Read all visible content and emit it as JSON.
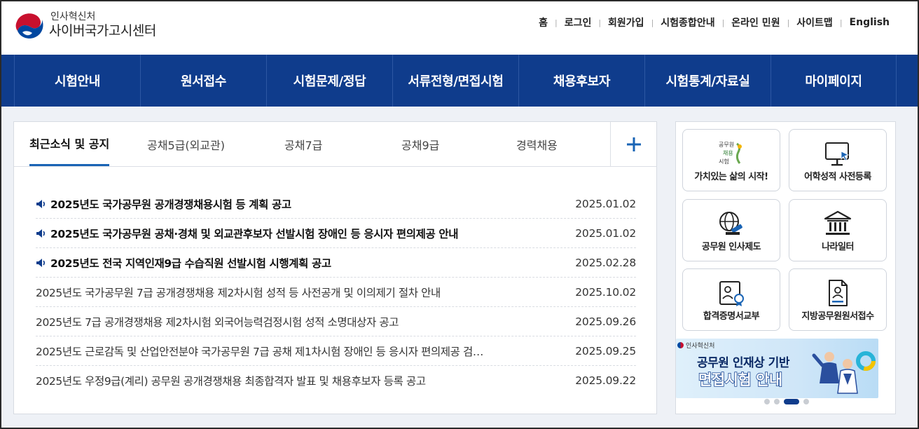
{
  "header": {
    "org": "인사혁신처",
    "site_name": "사이버국가고시센터",
    "util_links": [
      "홈",
      "로그인",
      "회원가입",
      "시험종합안내",
      "온라인 민원",
      "사이트맵",
      "English"
    ]
  },
  "nav": [
    "시험안내",
    "원서접수",
    "시험문제/정답",
    "서류전형/면접시험",
    "채용후보자",
    "시험통계/자료실",
    "마이페이지"
  ],
  "notice": {
    "tabs": [
      "최근소식 및 공지",
      "공채5급(외교관)",
      "공채7급",
      "공채9급",
      "경력채용"
    ],
    "active_tab": 0,
    "plus_icon": "plus-icon",
    "items": [
      {
        "title": "2025년도 국가공무원 공개경쟁채용시험 등 계획 공고",
        "date": "2025.01.02",
        "important": true
      },
      {
        "title": "2025년도 국가공무원 공채·경채 및 외교관후보자 선발시험 장애인 등 응시자 편의제공 안내",
        "date": "2025.01.02",
        "important": true
      },
      {
        "title": "2025년도 전국 지역인재9급 수습직원 선발시험 시행계획 공고",
        "date": "2025.02.28",
        "important": true
      },
      {
        "title": "2025년도 국가공무원 7급 공개경쟁채용 제2차시험 성적 등 사전공개 및 이의제기 절차 안내",
        "date": "2025.10.02",
        "important": false
      },
      {
        "title": "2025년도 7급 공개경쟁채용 제2차시험 외국어능력검정시험 성적 소명대상자 공고",
        "date": "2025.09.26",
        "important": false
      },
      {
        "title": "2025년도 근로감독 및 산업안전분야 국가공무원 7급 공채 제1차시험 장애인 등 응시자 편의제공 검…",
        "date": "2025.09.25",
        "important": false
      },
      {
        "title": "2025년도 우정9급(계리) 공무원 공개경쟁채용 최종합격자 발표 및 채용후보자 등록 공고",
        "date": "2025.09.22",
        "important": false
      }
    ]
  },
  "quick_links": [
    {
      "label": "가치있는 삶의 시작!",
      "icon": "public-servant-logo-icon",
      "logo_text": "공무원 채용 시험"
    },
    {
      "label": "어학성적 사전등록",
      "icon": "monitor-cursor-icon"
    },
    {
      "label": "공무원 인사제도",
      "icon": "globe-gavel-icon"
    },
    {
      "label": "나라일터",
      "icon": "government-building-icon"
    },
    {
      "label": "합격증명서교부",
      "icon": "certificate-icon"
    },
    {
      "label": "지방공무원원서접수",
      "icon": "document-person-icon"
    }
  ],
  "banner": {
    "org": "인사혁신처",
    "line1": "공무원 인재상 기반",
    "line2": "면접시험 안내",
    "slides": 4,
    "active_slide": 2
  },
  "colors": {
    "nav_bg": "#0f3c8c",
    "accent": "#1a64b5",
    "page_bg": "#eef1f6"
  }
}
